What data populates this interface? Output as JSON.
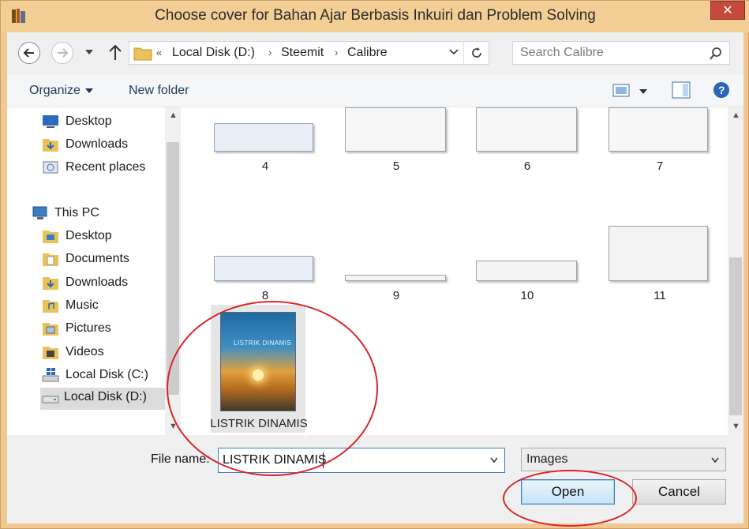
{
  "window": {
    "title": "Choose cover for Bahan Ajar Berbasis Inkuiri dan Problem Solving",
    "close_symbol": "✕"
  },
  "address": {
    "prefix": "«",
    "crumbs": [
      "Local Disk (D:)",
      "Steemit",
      "Calibre"
    ],
    "separator": "›"
  },
  "search": {
    "placeholder": "Search Calibre"
  },
  "toolbar": {
    "organize": "Organize",
    "new_folder": "New folder"
  },
  "sidebar": {
    "items": [
      {
        "label": "Desktop",
        "icon": "desktop-icon"
      },
      {
        "label": "Downloads",
        "icon": "downloads-folder-icon"
      },
      {
        "label": "Recent places",
        "icon": "recent-places-icon"
      },
      {
        "label": "This PC",
        "icon": "computer-icon"
      },
      {
        "label": "Desktop",
        "icon": "desktop-folder-icon"
      },
      {
        "label": "Documents",
        "icon": "documents-folder-icon"
      },
      {
        "label": "Downloads",
        "icon": "downloads-folder-icon"
      },
      {
        "label": "Music",
        "icon": "music-folder-icon"
      },
      {
        "label": "Pictures",
        "icon": "pictures-folder-icon"
      },
      {
        "label": "Videos",
        "icon": "videos-folder-icon"
      },
      {
        "label": "Local Disk (C:)",
        "icon": "windows-drive-icon"
      },
      {
        "label": "Local Disk (D:)",
        "icon": "drive-icon",
        "selected": true
      }
    ]
  },
  "files": {
    "items": [
      {
        "label": "4"
      },
      {
        "label": "5"
      },
      {
        "label": "6"
      },
      {
        "label": "7"
      },
      {
        "label": "8"
      },
      {
        "label": "9"
      },
      {
        "label": "10"
      },
      {
        "label": "11"
      },
      {
        "label": "LISTRIK DINAMIS",
        "cover_title": "LISTRIK DINAMIS",
        "selected": true
      }
    ]
  },
  "bottom": {
    "file_name_label": "File name:",
    "file_name_value": "LISTRIK DINAMIS",
    "file_type": "Images",
    "open_label": "Open",
    "cancel_label": "Cancel"
  },
  "colors": {
    "annotation": "#d9242a",
    "window_frame": "#f0c890",
    "focus_blue": "#3c7fb1"
  }
}
